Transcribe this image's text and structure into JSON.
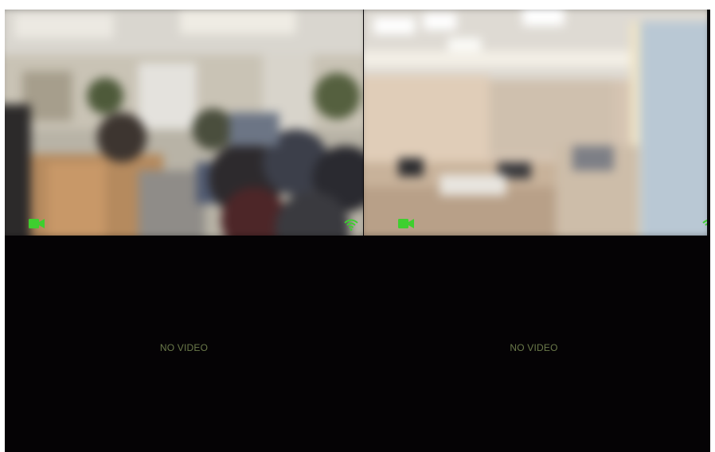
{
  "colors": {
    "background": "#050305",
    "status_green": "#3ecf2f",
    "no_video_text": "#6b7a4a"
  },
  "panes": [
    {
      "id": "camera-1",
      "status": "live",
      "icons": [
        "camera-recording-icon",
        "wifi-signal-icon"
      ]
    },
    {
      "id": "camera-2",
      "status": "live",
      "icons": [
        "camera-recording-icon",
        "wifi-signal-icon"
      ]
    },
    {
      "id": "camera-3",
      "status": "no-signal",
      "label": "NO VIDEO"
    },
    {
      "id": "camera-4",
      "status": "no-signal",
      "label": "NO VIDEO"
    }
  ]
}
